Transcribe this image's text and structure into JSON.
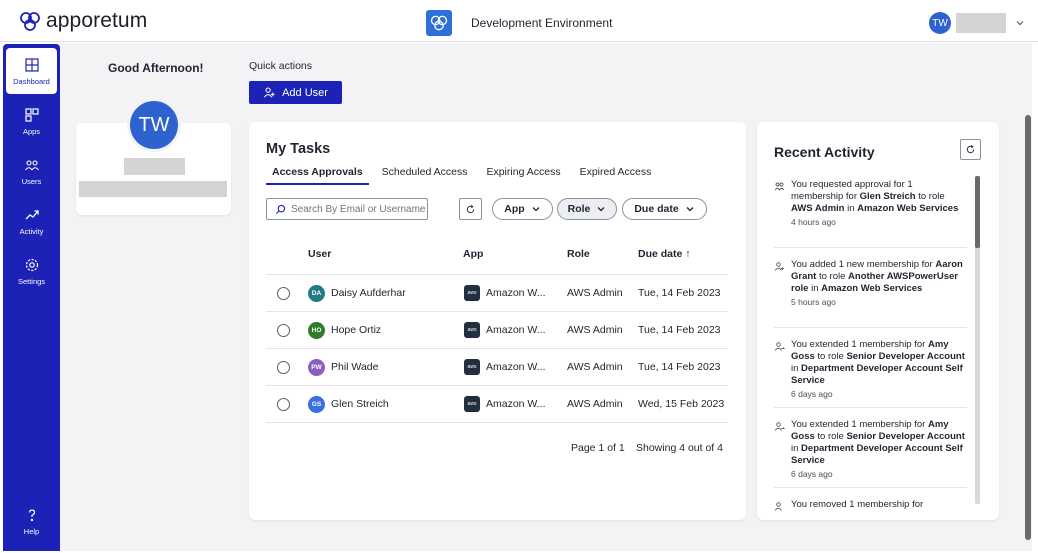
{
  "header": {
    "brand": "apporetum",
    "environment": "Development Environment",
    "user_initials": "TW"
  },
  "sidebar": {
    "items": [
      {
        "label": "Dashboard",
        "icon": "dashboard-icon"
      },
      {
        "label": "Apps",
        "icon": "apps-icon"
      },
      {
        "label": "Users",
        "icon": "users-icon"
      },
      {
        "label": "Activity",
        "icon": "activity-icon"
      },
      {
        "label": "Settings",
        "icon": "settings-icon"
      },
      {
        "label": "Help",
        "icon": "help-icon"
      }
    ]
  },
  "greeting": "Good Afternoon!",
  "profile": {
    "initials": "TW"
  },
  "quick_actions": {
    "label": "Quick actions",
    "add_user": "Add User"
  },
  "tasks": {
    "title": "My Tasks",
    "tabs": [
      "Access Approvals",
      "Scheduled Access",
      "Expiring Access",
      "Expired Access"
    ],
    "search_placeholder": "Search By Email or Username",
    "filters": [
      "App",
      "Role",
      "Due date"
    ],
    "columns": [
      "User",
      "App",
      "Role",
      "Due date ↑"
    ],
    "rows": [
      {
        "initials": "DA",
        "user": "Daisy Aufderhar",
        "app": "Amazon W...",
        "role": "AWS Admin",
        "due": "Tue, 14 Feb 2023",
        "color": "#1f7d83"
      },
      {
        "initials": "HO",
        "user": "Hope Ortiz",
        "app": "Amazon W...",
        "role": "AWS Admin",
        "due": "Tue, 14 Feb 2023",
        "color": "#2f7d2a"
      },
      {
        "initials": "PW",
        "user": "Phil Wade",
        "app": "Amazon W...",
        "role": "AWS Admin",
        "due": "Tue, 14 Feb 2023",
        "color": "#8a5fc2"
      },
      {
        "initials": "GS",
        "user": "Glen Streich",
        "app": "Amazon W...",
        "role": "AWS Admin",
        "due": "Wed, 15 Feb 2023",
        "color": "#3c6ee0"
      }
    ],
    "pager": "Page 1 of 1",
    "showing": "Showing 4 out of 4"
  },
  "activity": {
    "title": "Recent Activity",
    "items": [
      {
        "time": "4 hours ago"
      },
      {
        "time": "5 hours ago"
      },
      {
        "time": "6 days ago"
      },
      {
        "time": "6 days ago"
      },
      {
        "text": "You removed 1 membership for"
      }
    ]
  },
  "colors": {
    "primary": "#1d22b7",
    "avatar": "#2e63cf",
    "background": "#f3f3f5"
  }
}
